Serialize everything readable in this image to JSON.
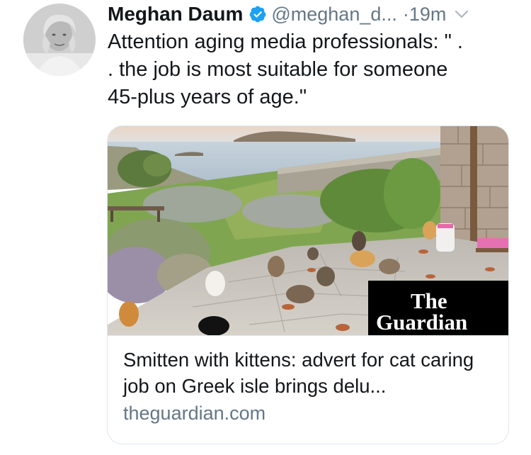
{
  "tweet": {
    "author": {
      "display_name": "Meghan Daum",
      "handle": "@meghan_d...",
      "verified": true
    },
    "timestamp": "·19m",
    "text": "Attention aging media professionals: \" .\n. the job is most suitable for someone\n45-plus years of age.\""
  },
  "card": {
    "image_badge": {
      "line1": "The",
      "line2": "Guardian"
    },
    "title": "Smitten with kittens: advert for cat caring job on Greek isle brings delu...",
    "domain": "theguardian.com"
  },
  "colors": {
    "text": "#14171a",
    "secondary": "#657786",
    "verified": "#1da1f2",
    "border": "#e1e8ed"
  },
  "icons": [
    "verified-badge-icon",
    "chevron-down-icon"
  ]
}
